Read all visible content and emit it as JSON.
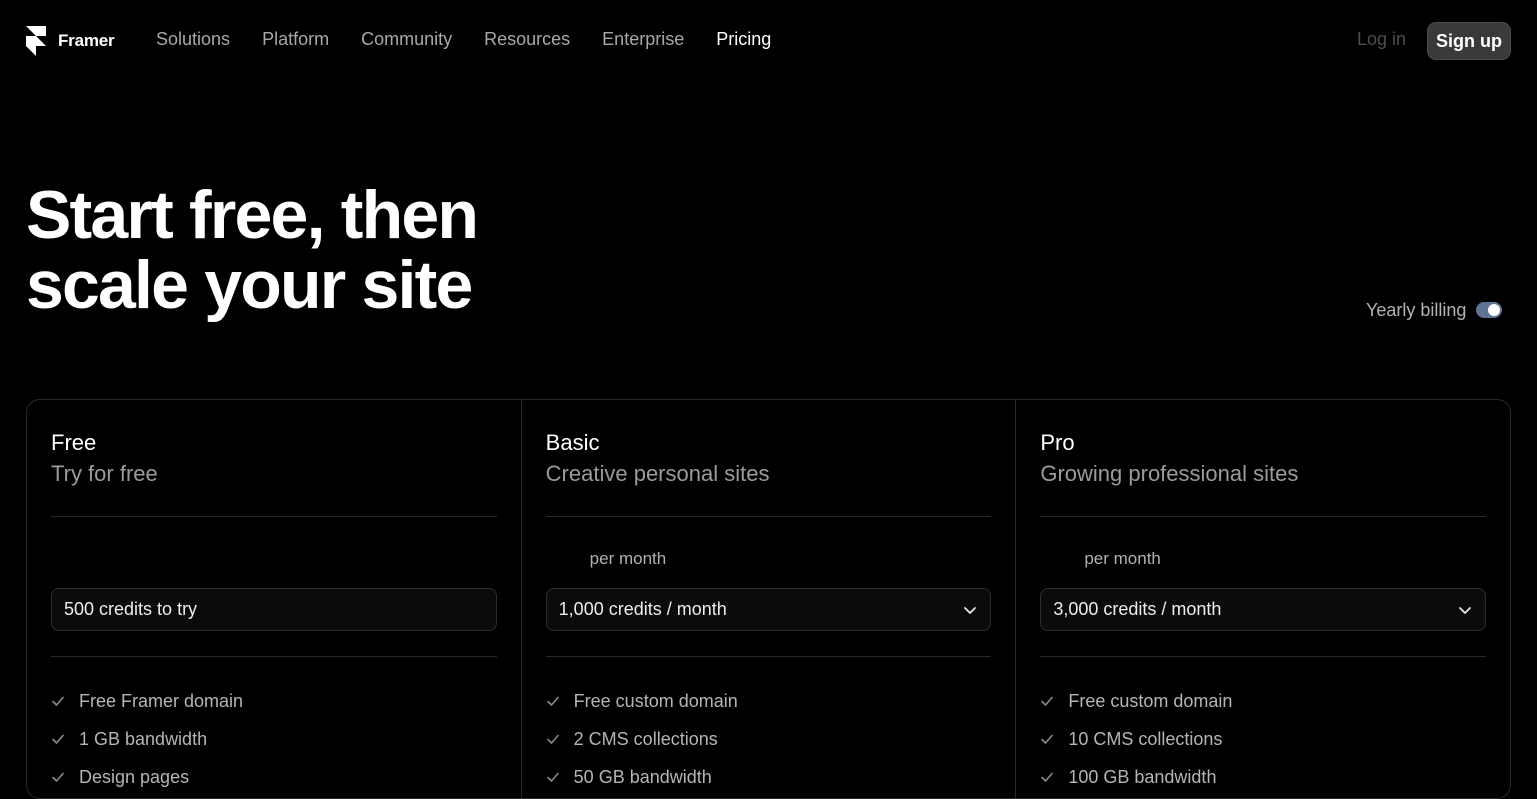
{
  "nav": {
    "brand": "Framer",
    "links": [
      {
        "label": "Solutions"
      },
      {
        "label": "Platform"
      },
      {
        "label": "Community"
      },
      {
        "label": "Resources"
      },
      {
        "label": "Enterprise"
      },
      {
        "label": "Pricing",
        "active": true
      }
    ],
    "login_label": "Log in",
    "signup_label": "Sign up"
  },
  "hero": {
    "title_line1": "Start free, then",
    "title_line2": "scale your site"
  },
  "billing": {
    "label": "Yearly billing",
    "enabled": true
  },
  "plans": [
    {
      "name": "Free",
      "tagline": "Try for free",
      "price_period": "",
      "credits": "500 credits to try",
      "has_dropdown": false,
      "features": [
        "Free Framer domain",
        "1 GB bandwidth",
        "Design pages"
      ]
    },
    {
      "name": "Basic",
      "tagline": "Creative personal sites",
      "price_period": "per month",
      "credits": "1,000 credits / month",
      "has_dropdown": true,
      "features": [
        "Free custom domain",
        "2 CMS collections",
        "50 GB bandwidth"
      ]
    },
    {
      "name": "Pro",
      "tagline": "Growing professional sites",
      "price_period": "per month",
      "credits": "3,000 credits / month",
      "has_dropdown": true,
      "features": [
        "Free custom domain",
        "10 CMS collections",
        "100 GB bandwidth"
      ]
    }
  ]
}
